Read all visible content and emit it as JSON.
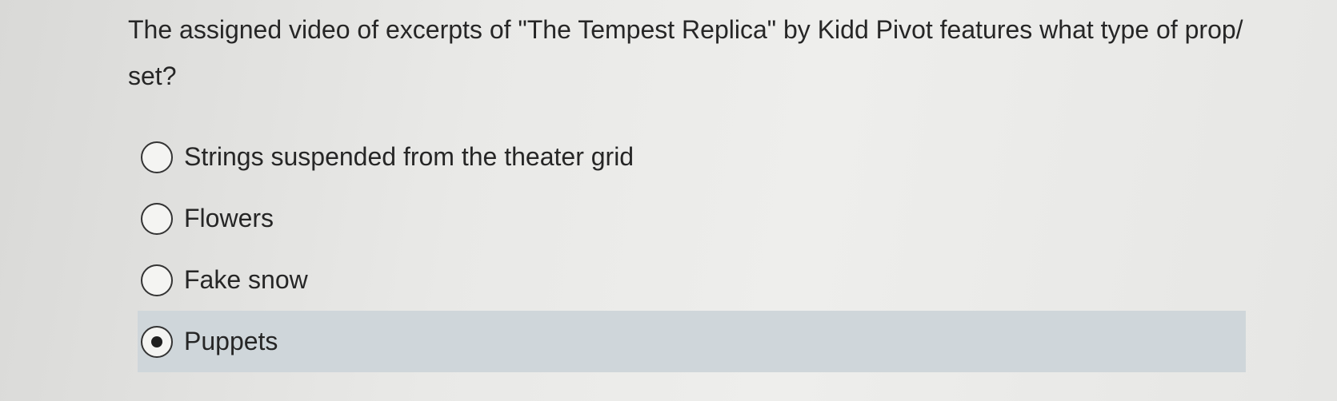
{
  "question": {
    "text": "The assigned video of excerpts of \"The Tempest Replica\" by Kidd Pivot features what type of prop/ set?"
  },
  "options": [
    {
      "label": "Strings suspended from the theater grid",
      "selected": false
    },
    {
      "label": "Flowers",
      "selected": false
    },
    {
      "label": "Fake snow",
      "selected": false
    },
    {
      "label": "Puppets",
      "selected": true
    }
  ],
  "colors": {
    "selected_highlight": "#cfd6da",
    "text": "#262626"
  }
}
